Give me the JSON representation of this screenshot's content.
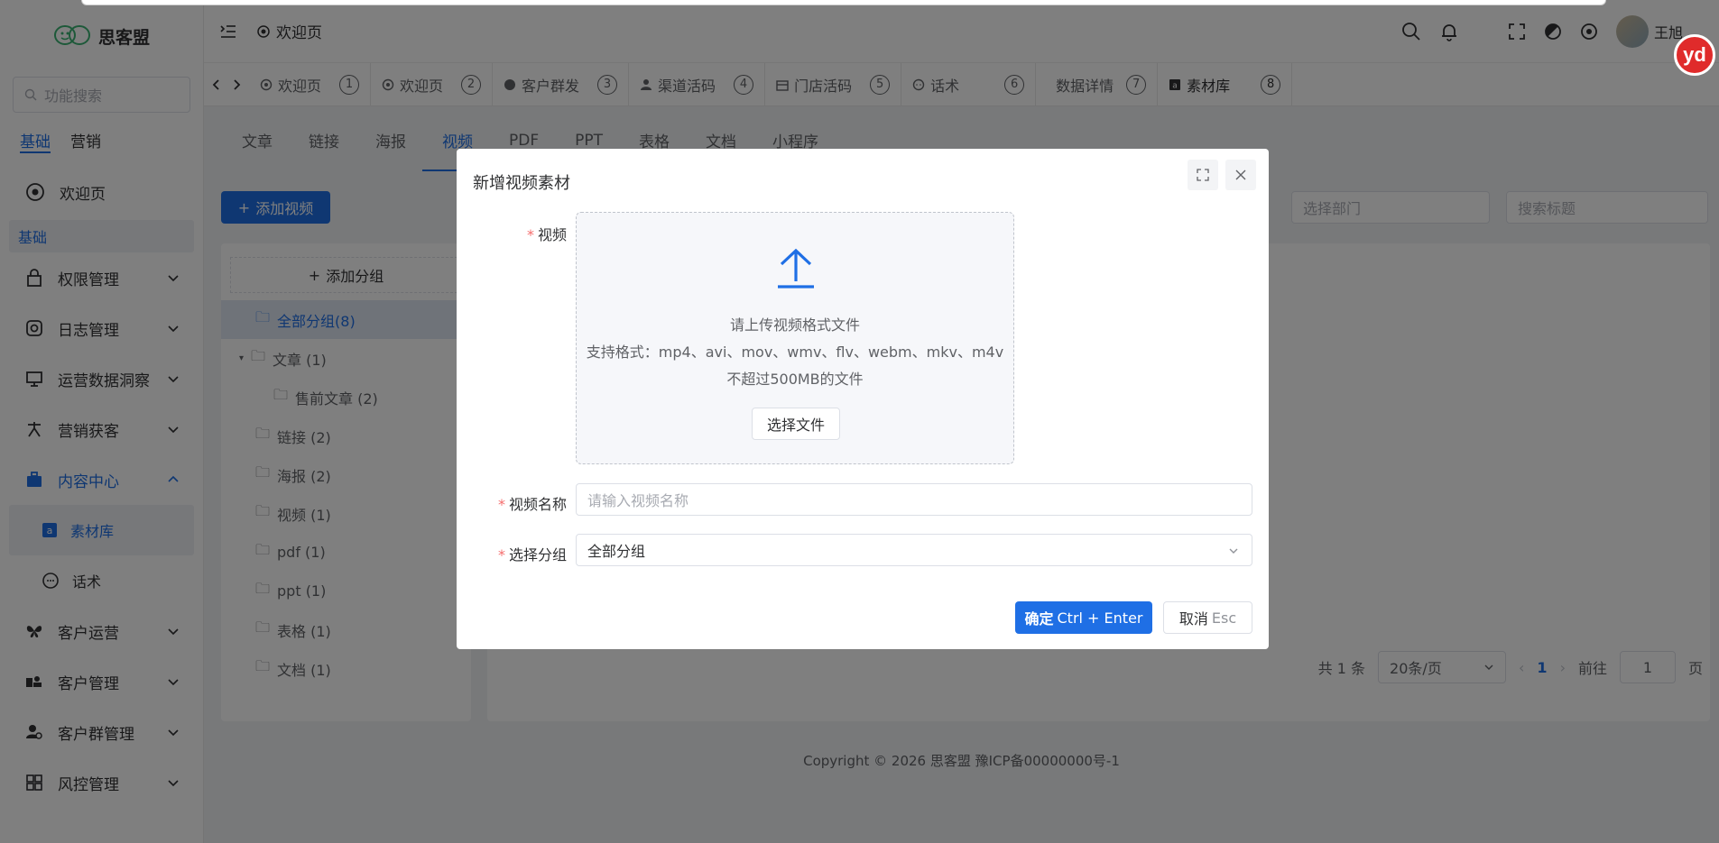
{
  "sidebar": {
    "brand": "思客盟",
    "search_placeholder": "功能搜索",
    "tabs": [
      "基础",
      "营销"
    ],
    "welcome": "欢迎页",
    "group_title": "基础",
    "items": [
      "权限管理",
      "日志管理",
      "运营数据洞察",
      "营销获客",
      "内容中心"
    ],
    "sub_items": [
      "素材库",
      "话术"
    ],
    "items_after": [
      "客户运营",
      "客户管理",
      "客户群管理",
      "风控管理"
    ]
  },
  "header": {
    "crumb": "欢迎页",
    "user": "王旭"
  },
  "tabbar": {
    "tags": [
      {
        "label": "欢迎页",
        "num": "1"
      },
      {
        "label": "欢迎页",
        "num": "2"
      },
      {
        "label": "客户群发",
        "num": "3"
      },
      {
        "label": "渠道活码",
        "num": "4"
      },
      {
        "label": "门店活码",
        "num": "5"
      },
      {
        "label": "话术",
        "num": "6"
      },
      {
        "label": "数据详情",
        "num": "7"
      },
      {
        "label": "素材库",
        "num": "8"
      }
    ]
  },
  "content": {
    "sub_tabs": [
      "文章",
      "链接",
      "海报",
      "视频",
      "PDF",
      "PPT",
      "表格",
      "文档",
      "小程序"
    ],
    "add_video": "添加视频",
    "add_group": "添加分组",
    "tree": [
      "全部分组(8)",
      "文章 (1)",
      "售前文章 (2)",
      "链接 (2)",
      "海报 (2)",
      "视频 (1)",
      "pdf (1)",
      "ppt (1)",
      "表格 (1)",
      "文档 (1)"
    ],
    "dept_placeholder": "选择部门",
    "title_placeholder": "搜索标题",
    "pager": {
      "total": "共 1 条",
      "size": "20条/页",
      "current": "1",
      "goto_label": "前往",
      "goto_value": "1",
      "page_label": "页"
    },
    "footer": "Copyright © 2026 思客盟 豫ICP备00000000号-1"
  },
  "dialog": {
    "title": "新增视频素材",
    "video_label": "视频",
    "upload_line1": "请上传视频格式文件",
    "upload_line2": "支持格式：mp4、avi、mov、wmv、flv、webm、mkv、m4v",
    "upload_line3": "不超过500MB的文件",
    "choose_file": "选择文件",
    "name_label": "视频名称",
    "name_placeholder": "请输入视频名称",
    "group_label": "选择分组",
    "group_value": "全部分组",
    "confirm_label": "确定",
    "confirm_hint": "Ctrl + Enter",
    "cancel_label": "取消",
    "cancel_hint": "Esc"
  },
  "badge": "yd",
  "colors": {
    "accent": "#1f6fe5",
    "required": "#f56c6c",
    "overlay": "rgba(0,0,0,0.5)"
  }
}
